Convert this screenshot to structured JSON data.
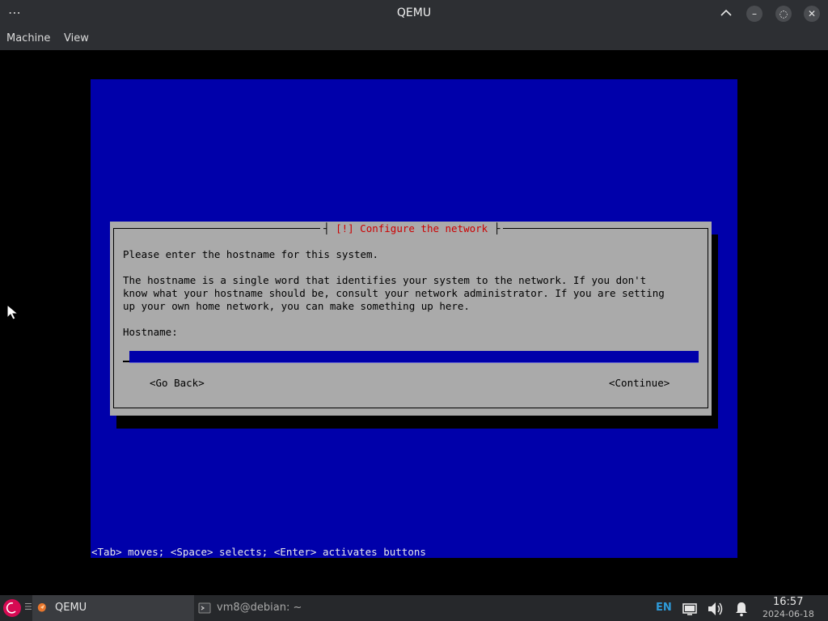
{
  "window": {
    "title": "QEMU",
    "menu": [
      "Machine",
      "View"
    ]
  },
  "installer": {
    "dialog_title": "[!] Configure the network",
    "prompt": "Please enter the hostname for this system.",
    "description_lines": [
      "The hostname is a single word that identifies your system to the network. If you don't",
      "know what your hostname should be, consult your network administrator. If you are setting",
      "up your own home network, you can make something up here."
    ],
    "field_label": "Hostname:",
    "hostname_value": "",
    "buttons": {
      "back": "<Go Back>",
      "continue": "<Continue>"
    },
    "help_line": "<Tab> moves; <Space> selects; <Enter> activates buttons"
  },
  "taskbar": {
    "tasks": [
      {
        "label": "QEMU",
        "active": true,
        "icon": "qemu-icon"
      },
      {
        "label": "vm8@debian: ~",
        "active": false,
        "icon": "terminal-icon"
      }
    ],
    "language": "EN",
    "clock": {
      "time": "16:57",
      "date": "2024-06-18"
    }
  },
  "colors": {
    "installer_blue": "#0000aa",
    "dialog_gray": "#aaaaaa",
    "title_red": "#cc0000",
    "debian_red": "#d70a53",
    "lang_blue": "#2e9ad8"
  }
}
